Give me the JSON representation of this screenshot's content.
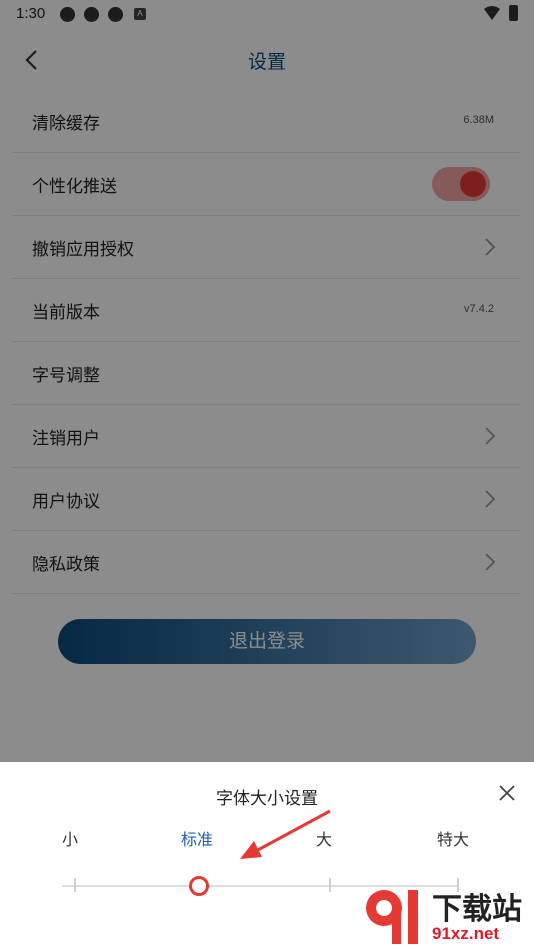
{
  "status_bar": {
    "time": "1:30",
    "app_icon_letter": "A"
  },
  "header": {
    "title": "设置"
  },
  "settings": {
    "clear_cache": {
      "label": "清除缓存",
      "value": "6.38M"
    },
    "personalized_push": {
      "label": "个性化推送",
      "enabled": true
    },
    "revoke_auth": {
      "label": "撤销应用授权"
    },
    "current_version": {
      "label": "当前版本",
      "value": "v7.4.2"
    },
    "font_size": {
      "label": "字号调整"
    },
    "cancel_account": {
      "label": "注销用户"
    },
    "user_agreement": {
      "label": "用户协议"
    },
    "privacy_policy": {
      "label": "隐私政策"
    }
  },
  "logout": {
    "label": "退出登录"
  },
  "font_sheet": {
    "title": "字体大小设置",
    "options": [
      "小",
      "标准",
      "大",
      "特大"
    ],
    "selected": "标准"
  },
  "watermark": {
    "top": "下载站",
    "bottom": "91xz.net"
  },
  "colors": {
    "accent_blue": "#0d4c7c",
    "toggle_red": "#e53935",
    "selected_blue": "#1f5fa8"
  }
}
